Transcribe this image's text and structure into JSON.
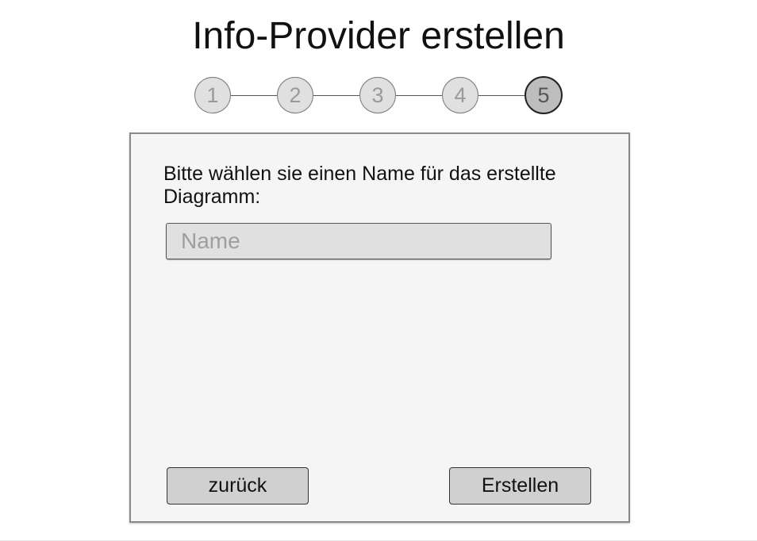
{
  "page": {
    "title": "Info-Provider erstellen"
  },
  "stepper": {
    "steps": [
      {
        "label": "1",
        "state": "inactive"
      },
      {
        "label": "2",
        "state": "inactive"
      },
      {
        "label": "3",
        "state": "inactive"
      },
      {
        "label": "4",
        "state": "inactive"
      },
      {
        "label": "5",
        "state": "active"
      }
    ],
    "current_step": 5
  },
  "form": {
    "prompt": "Bitte wählen sie einen Name für das erstellte Diagramm:",
    "name_field": {
      "value": "",
      "placeholder": "Name"
    },
    "back_label": "zurück",
    "create_label": "Erstellen"
  },
  "colors": {
    "panel_background": "#f5f5f5",
    "panel_border": "#8a8a8a",
    "input_background": "#e0e0e0",
    "button_background": "#d0d0d0",
    "step_inactive": "#e0e0e0",
    "step_active": "#bdbdbd"
  }
}
